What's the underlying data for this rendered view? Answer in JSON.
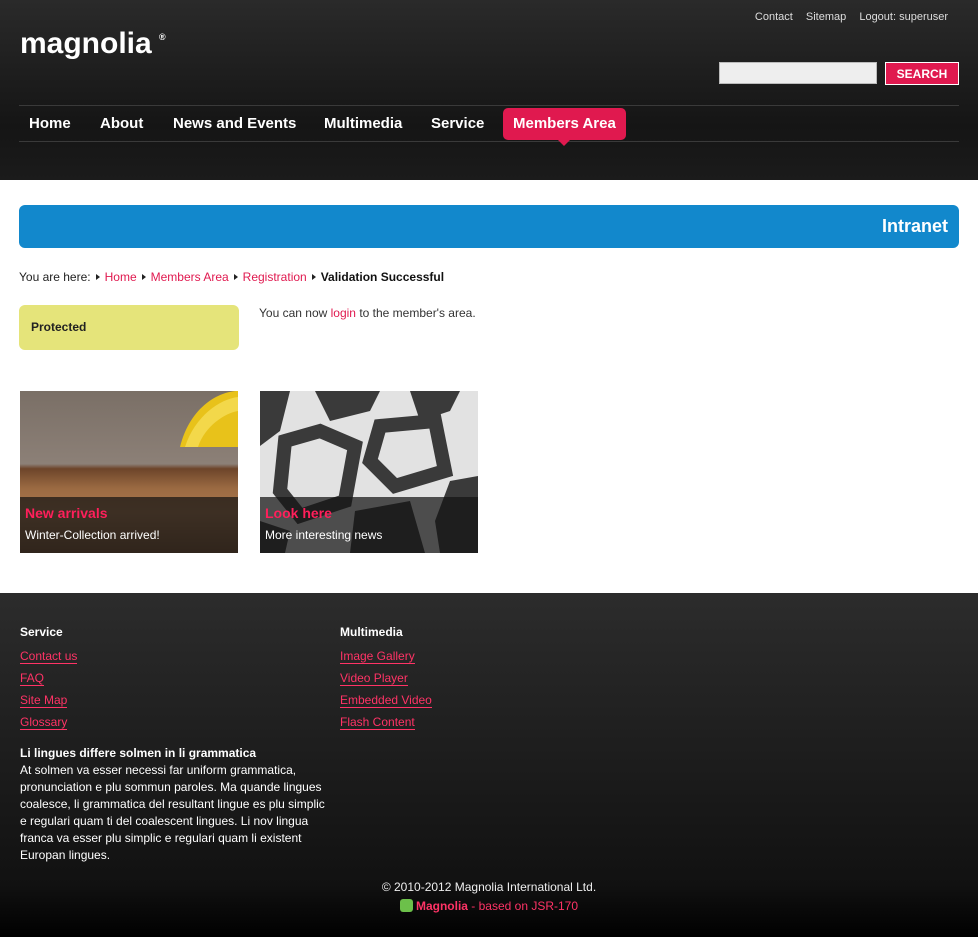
{
  "header": {
    "logo_text": "magnolia",
    "top_links": [
      "Contact",
      "Sitemap",
      "Logout: superuser"
    ],
    "search": {
      "value": "",
      "button_label": "SEARCH"
    },
    "nav": [
      "Home",
      "About",
      "News and Events",
      "Multimedia",
      "Service",
      "Members Area"
    ],
    "active_nav": "Members Area"
  },
  "banner": {
    "title": "Intranet",
    "color": "#1288cc"
  },
  "breadcrumb": {
    "prefix": "You are here:",
    "items": [
      "Home",
      "Members Area",
      "Registration"
    ],
    "current": "Validation Successful"
  },
  "sidebar": {
    "protected_label": "Protected"
  },
  "message": {
    "before": "You can now ",
    "link": "login",
    "after": " to the member's area."
  },
  "teasers": [
    {
      "title": "New arrivals",
      "subtitle": "Winter-Collection arrived!"
    },
    {
      "title": "Look here",
      "subtitle": "More interesting news"
    }
  ],
  "footer": {
    "columns": [
      {
        "heading": "Service",
        "links": [
          "Contact us",
          "FAQ",
          "Site Map",
          "Glossary"
        ]
      },
      {
        "heading": "Multimedia",
        "links": [
          "Image Gallery",
          "Video Player",
          "Embedded Video",
          "Flash Content"
        ]
      }
    ],
    "text_title": "Li lingues differe solmen in li grammatica",
    "text_body": "At solmen va esser necessi far uniform grammatica, pronunciation e plu sommun paroles. Ma quande lingues coalesce, li grammatica del resultant lingue es plu simplic e regulari quam ti del coalescent lingues. Li nov lingua franca va esser plu simplic e regulari quam li existent Europan lingues.",
    "copyright": "© 2010-2012 Magnolia International Ltd.",
    "powered_brand": "Magnolia",
    "powered_rest": " - based on JSR-170"
  },
  "colors": {
    "accent": "#e0194f",
    "protected_bg": "#e5e47a"
  }
}
